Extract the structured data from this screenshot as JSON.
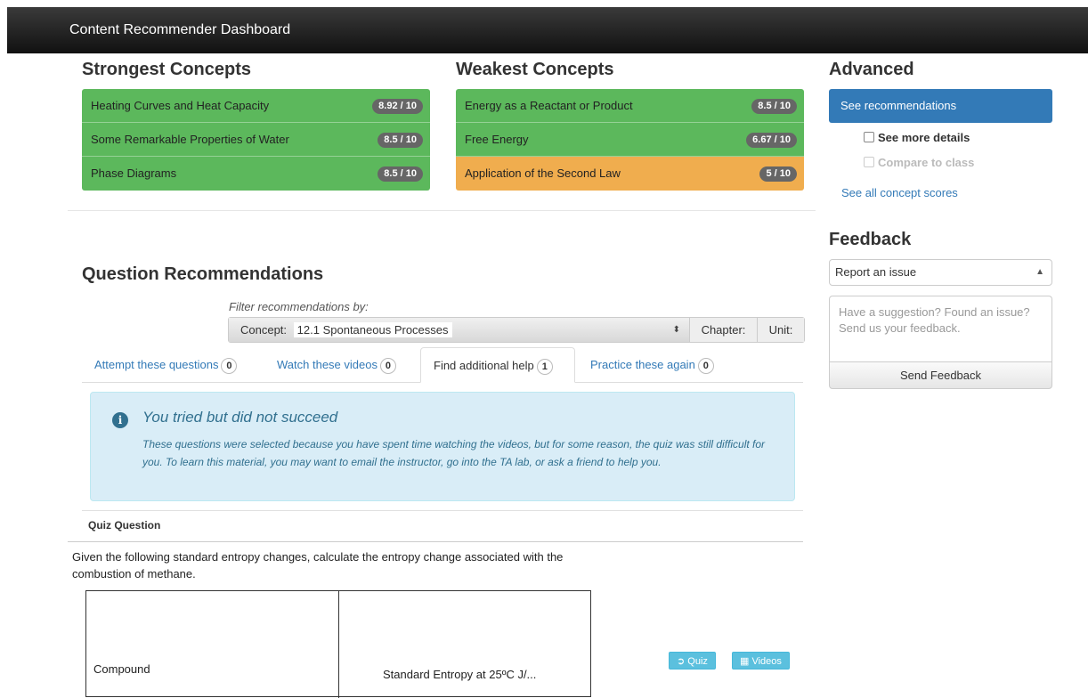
{
  "navbar": {
    "title": "Content Recommender Dashboard"
  },
  "strongest": {
    "heading": "Strongest Concepts",
    "items": [
      {
        "label": "Heating Curves and Heat Capacity",
        "score": "8.92 / 10"
      },
      {
        "label": "Some Remarkable Properties of Water",
        "score": "8.5 / 10"
      },
      {
        "label": "Phase Diagrams",
        "score": "8.5 / 10"
      }
    ]
  },
  "weakest": {
    "heading": "Weakest Concepts",
    "items": [
      {
        "label": "Energy as a Reactant or Product",
        "score": "8.5 / 10"
      },
      {
        "label": "Free Energy",
        "score": "6.67 / 10"
      },
      {
        "label": "Application of the Second Law",
        "score": "5 / 10"
      }
    ]
  },
  "advanced": {
    "heading": "Advanced",
    "recommend_button": "See recommendations",
    "more_details": "See more details",
    "compare": "Compare to class",
    "all_scores_link": "See all concept scores"
  },
  "feedback": {
    "heading": "Feedback",
    "select_value": "Report an issue",
    "textarea_placeholder": "Have a suggestion? Found an issue? Send us your feedback.",
    "send_button": "Send Feedback"
  },
  "recommendations": {
    "heading": "Question Recommendations",
    "filter_label": "Filter recommendations by:",
    "concept_label": "Concept:",
    "concept_value": "12.1 Spontaneous Processes",
    "chapter_label": "Chapter:",
    "unit_label": "Unit:",
    "tabs": [
      {
        "label": "Attempt these questions",
        "count": "0"
      },
      {
        "label": "Watch these videos",
        "count": "0"
      },
      {
        "label": "Find additional help",
        "count": "1"
      },
      {
        "label": "Practice these again",
        "count": "0"
      }
    ]
  },
  "alert": {
    "title": "You tried but did not succeed",
    "body": "These questions were selected because you have spent time watching the videos, but for some reason, the quiz was still difficult for you. To learn this material, you may want to email the instructor, go into the TA lab, or ask a friend to help you."
  },
  "quiz": {
    "heading": "Quiz Question",
    "text": "Given the following standard entropy changes, calculate the entropy change associated with the combustion of methane.",
    "table_col1": "Compound",
    "table_col2": "Standard Entropy at 25ºC  J/...",
    "quiz_button": "Quiz",
    "videos_button": "Videos"
  },
  "colors": {
    "green": "#5cb85c",
    "orange": "#f0ad4e",
    "primary": "#337ab7",
    "info_bg": "#d9edf7"
  }
}
